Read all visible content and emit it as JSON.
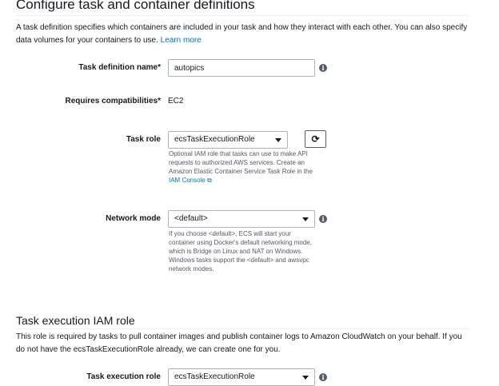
{
  "section1": {
    "title": "Configure task and container definitions",
    "description": "A task definition specifies which containers are included in your task and how they interact with each other. You can also specify data volumes for your containers to use.",
    "learn_more": "Learn more"
  },
  "fields": {
    "task_definition_name": {
      "label": "Task definition name",
      "required_mark": "*",
      "value": "autopics"
    },
    "requires_compatibilities": {
      "label": "Requires compatibilities",
      "required_mark": "*",
      "value": "EC2"
    },
    "task_role": {
      "label": "Task role",
      "value": "ecsTaskExecutionRole",
      "help": "Optional IAM role that tasks can use to make API requests to authorized AWS services. Create an Amazon Elastic Container Service Task Role in the",
      "help_link": "IAM Console"
    },
    "network_mode": {
      "label": "Network mode",
      "value": "<default>",
      "help": "If you choose <default>, ECS will start your container using Docker's default networking mode, which is Bridge on Linux and NAT on Windows. Windows tasks support the <default> and awsvpc network modes."
    }
  },
  "section2": {
    "title": "Task execution IAM role",
    "description": "This role is required by tasks to pull container images and publish container logs to Amazon CloudWatch on your behalf. If you do not have the ecsTaskExecutionRole already, we can create one for you.",
    "task_execution_role": {
      "label": "Task execution role",
      "value": "ecsTaskExecutionRole"
    }
  },
  "icons": {
    "info": "info-icon",
    "refresh": "refresh-icon",
    "external_link": "external-link-icon",
    "dropdown": "chevron-down-icon"
  },
  "glyphs": {
    "info": "i",
    "refresh": "⟳",
    "external_link": "⧉"
  },
  "colors": {
    "link": "#0073bb",
    "border": "#aab7b8",
    "text": "#16191f",
    "muted": "#545b64"
  }
}
